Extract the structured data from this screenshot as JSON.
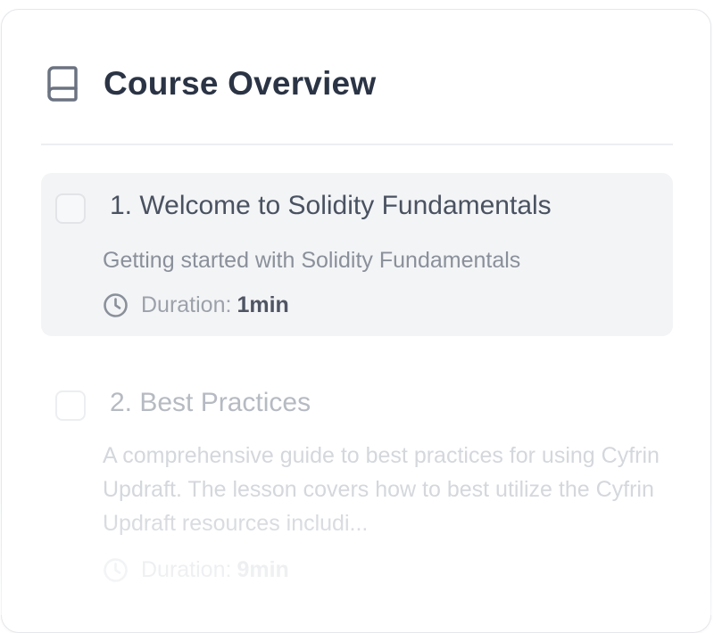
{
  "header": {
    "title": "Course Overview",
    "icon": "book-icon"
  },
  "lessons": [
    {
      "title": "1. Welcome to Solidity Fundamentals",
      "description": "Getting started with Solidity Fundamentals",
      "duration_label": "Duration:",
      "duration_value": "1min",
      "active": true,
      "checked": false
    },
    {
      "title": "2. Best Practices",
      "description": "A comprehensive guide to best practices for using Cyfrin Updraft. The lesson covers how to best utilize the Cyfrin Updraft resources includi...",
      "duration_label": "Duration:",
      "duration_value": "9min",
      "active": false,
      "checked": false
    }
  ],
  "colors": {
    "title_text": "#2b3445",
    "active_bg": "#f3f4f6",
    "muted_text": "#8a909a",
    "border": "#e5e7eb"
  }
}
